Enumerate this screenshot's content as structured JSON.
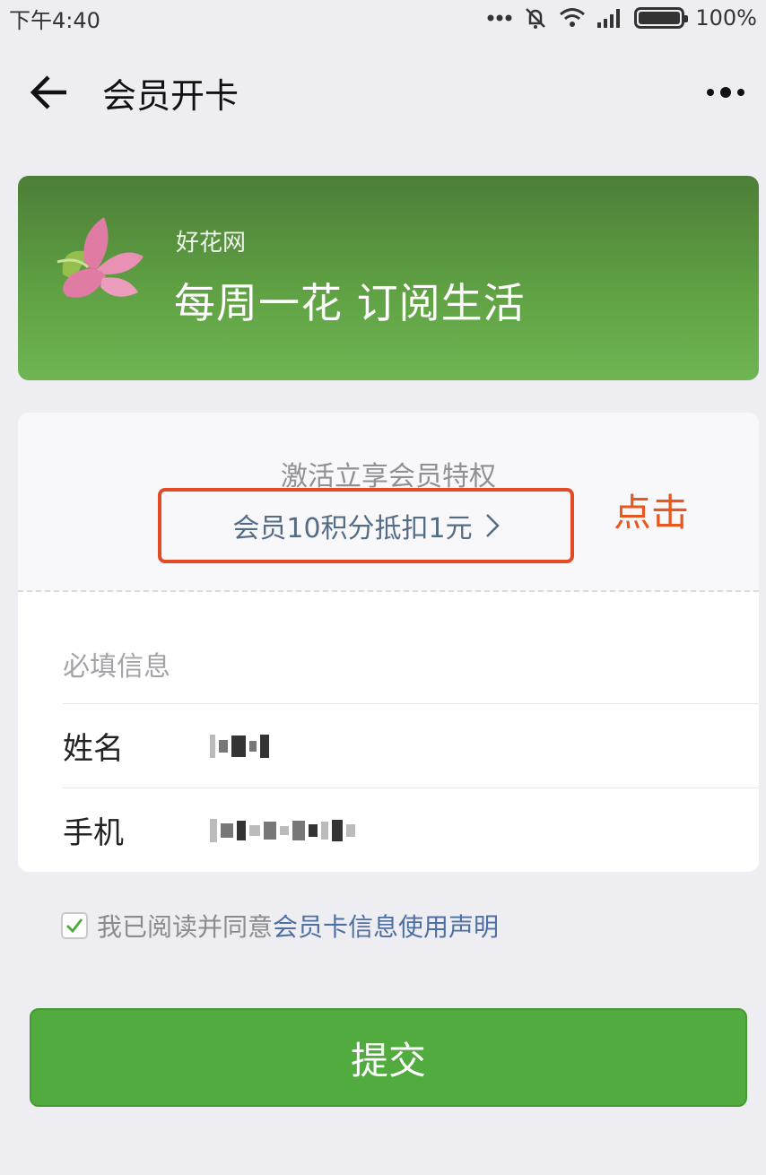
{
  "status_bar": {
    "time": "下午4:40",
    "battery": "100%",
    "icons": [
      "dots-icon",
      "mute-icon",
      "wifi-icon",
      "signal-icon",
      "battery-icon"
    ]
  },
  "navbar": {
    "title": "会员开卡",
    "back_icon": "arrow-left-icon",
    "more_icon": "more-dots-icon"
  },
  "banner": {
    "brand": "好花网",
    "slogan": "每周一花 订阅生活",
    "logo_icon": "flower-logo-icon"
  },
  "privilege": {
    "title": "激活立享会员特权",
    "link": "会员10积分抵扣1元"
  },
  "annotation": {
    "text": "点击",
    "color": "#e8571d"
  },
  "form": {
    "section_label": "必填信息",
    "fields": [
      {
        "label": "姓名"
      },
      {
        "label": "手机"
      }
    ]
  },
  "agreement": {
    "checked": true,
    "text": "我已阅读并同意",
    "link": "会员卡信息使用声明"
  },
  "submit": {
    "label": "提交",
    "color": "#52ab3f"
  }
}
